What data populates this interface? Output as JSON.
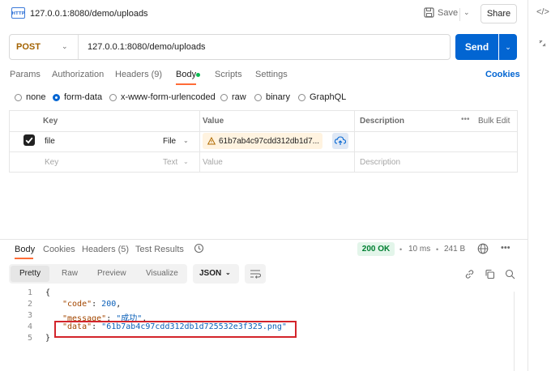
{
  "header": {
    "request_url_title": "127.0.0.1:8080/demo/uploads",
    "save_label": "Save",
    "share_label": "Share"
  },
  "request": {
    "method": "POST",
    "url": "127.0.0.1:8080/demo/uploads",
    "send_label": "Send"
  },
  "tabs": {
    "params": "Params",
    "authorization": "Authorization",
    "headers": "Headers (9)",
    "body": "Body",
    "scripts": "Scripts",
    "settings": "Settings",
    "cookies": "Cookies"
  },
  "body_types": [
    "none",
    "form-data",
    "x-www-form-urlencoded",
    "raw",
    "binary",
    "GraphQL"
  ],
  "form_table": {
    "headers": {
      "key": "Key",
      "value": "Value",
      "description": "Description",
      "bulk_edit": "Bulk Edit"
    },
    "rows": [
      {
        "key": "file",
        "type": "File",
        "value": "61b7ab4c97cdd312db1d7...",
        "checked": true
      }
    ],
    "placeholder": {
      "key": "Key",
      "type": "Text",
      "value": "Value",
      "description": "Description"
    }
  },
  "response": {
    "tabs": {
      "body": "Body",
      "cookies": "Cookies",
      "headers": "Headers (5)",
      "test_results": "Test Results"
    },
    "status": "200 OK",
    "time": "10 ms",
    "size": "241 B",
    "view_modes": {
      "pretty": "Pretty",
      "raw": "Raw",
      "preview": "Preview",
      "visualize": "Visualize"
    },
    "format": "JSON",
    "code_lines": {
      "n1": "1",
      "n2": "2",
      "n3": "3",
      "n4": "4",
      "n5": "5",
      "open_brace": "{",
      "k_code": "\"code\"",
      "v_code": "200",
      "k_message": "\"message\"",
      "v_message": "\"成功\"",
      "k_data": "\"data\"",
      "v_data": "\"61b7ab4c97cdd312db1d725532e3f325.png\"",
      "close_brace": "}"
    }
  },
  "colors": {
    "accent": "#0265d2",
    "tab_indicator": "#ff6c37",
    "success": "#007f31",
    "highlight_box": "#d3242b"
  }
}
